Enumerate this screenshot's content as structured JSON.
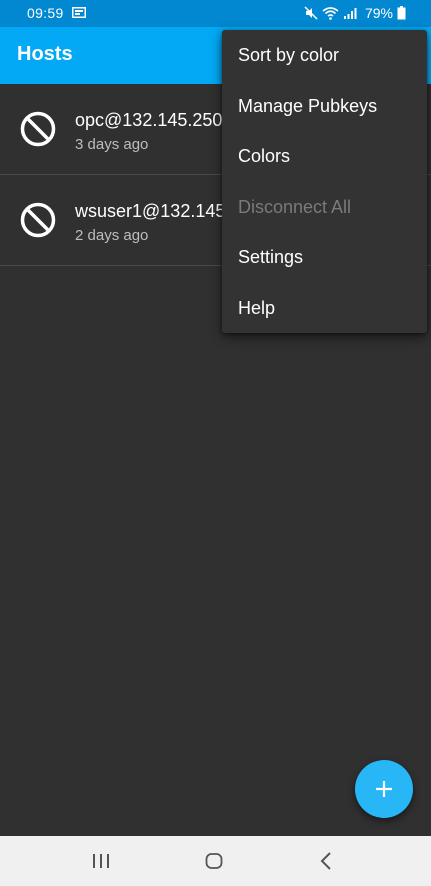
{
  "status_bar": {
    "time": "09:59",
    "battery_percent": "79%",
    "icons": [
      "screen-record-icon",
      "mute-icon",
      "wifi-icon",
      "signal-icon",
      "battery-icon"
    ]
  },
  "app_bar": {
    "title": "Hosts"
  },
  "hosts": [
    {
      "name": "opc@132.145.250",
      "last_connected": "3 days ago",
      "status_icon": "disconnected-icon"
    },
    {
      "name": "wsuser1@132.145",
      "last_connected": "2 days ago",
      "status_icon": "disconnected-icon"
    }
  ],
  "overflow_menu": {
    "items": [
      {
        "label": "Sort by color",
        "enabled": true
      },
      {
        "label": "Manage Pubkeys",
        "enabled": true
      },
      {
        "label": "Colors",
        "enabled": true
      },
      {
        "label": "Disconnect All",
        "enabled": false
      },
      {
        "label": "Settings",
        "enabled": true
      },
      {
        "label": "Help",
        "enabled": true
      }
    ]
  },
  "fab": {
    "icon": "plus-icon"
  },
  "nav_bar": {
    "icons": [
      "recents-icon",
      "home-icon",
      "back-icon"
    ]
  },
  "colors": {
    "status_bar": "#0288d1",
    "app_bar": "#03a9f4",
    "background": "#303030",
    "menu": "#333333",
    "fab": "#29b6f6",
    "nav_bar": "#f0f0f0",
    "disabled_text": "#7a7a7a"
  }
}
